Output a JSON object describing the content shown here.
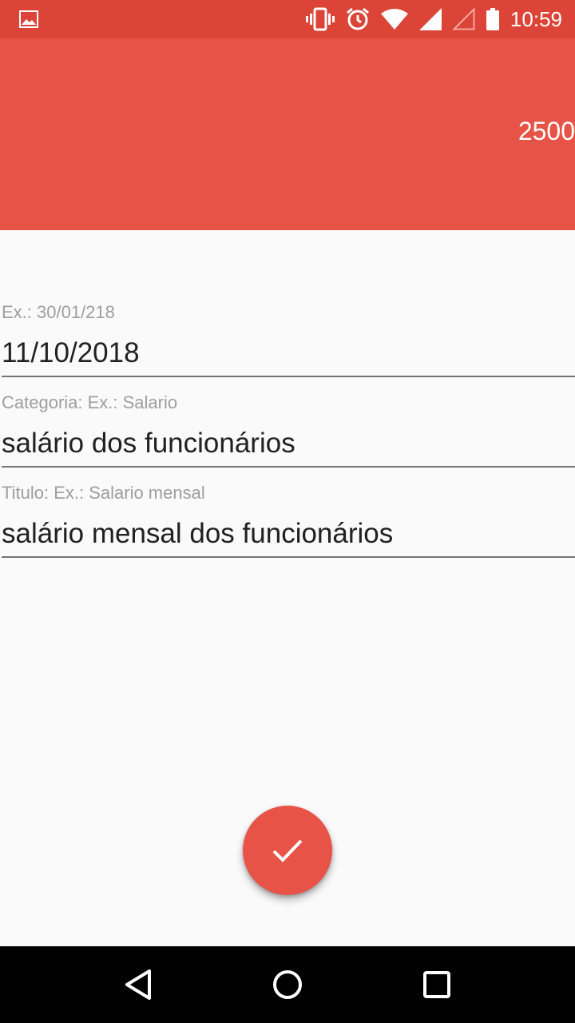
{
  "status_bar": {
    "time": "10:59",
    "icons": [
      "image-notification-icon",
      "vibrate-icon",
      "alarm-icon",
      "wifi-icon",
      "signal-icon",
      "signal-empty-icon",
      "battery-icon"
    ],
    "background_color": "#db4437"
  },
  "header": {
    "amount": "2500",
    "background_color": "#e85347"
  },
  "form": {
    "date": {
      "hint": "Ex.: 30/01/218",
      "value": "11/10/2018"
    },
    "category": {
      "hint": "Categoria: Ex.: Salario",
      "value": "salário dos funcionários"
    },
    "title": {
      "hint": "Titulo: Ex.: Salario mensal",
      "value": "salário mensal dos funcionários"
    }
  },
  "fab": {
    "icon": "check-icon",
    "color": "#e85347"
  },
  "nav_bar": {
    "icons": [
      "back-icon",
      "home-icon",
      "recents-icon"
    ]
  }
}
